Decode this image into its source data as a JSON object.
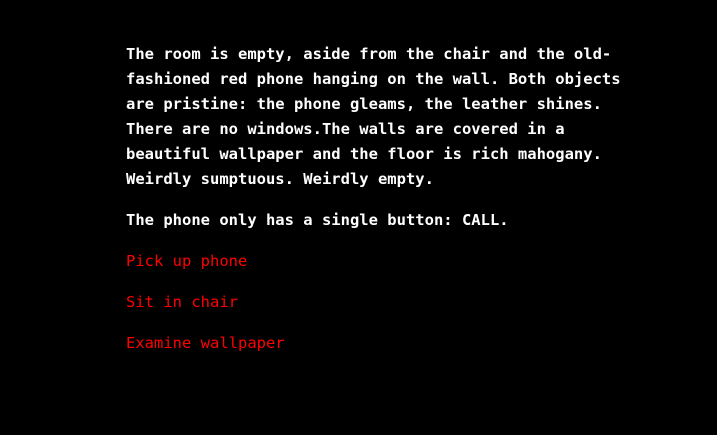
{
  "story": {
    "paragraph1": [
      "The room is empty, aside from the chair and the old-",
      "fashioned red phone hanging on the wall. Both objects",
      "are pristine: the phone gleams, the leather shines.",
      "There are no windows.The walls are covered in a",
      "beautiful wallpaper and the floor is rich mahogany.",
      "Weirdly sumptuous. Weirdly empty."
    ],
    "paragraph2": "The phone only has a single button: CALL."
  },
  "choices": [
    {
      "label": "Pick up phone"
    },
    {
      "label": "Sit in chair"
    },
    {
      "label": "Examine wallpaper"
    }
  ],
  "colors": {
    "background": "#000000",
    "text": "#ffffff",
    "link": "#ff0000"
  }
}
